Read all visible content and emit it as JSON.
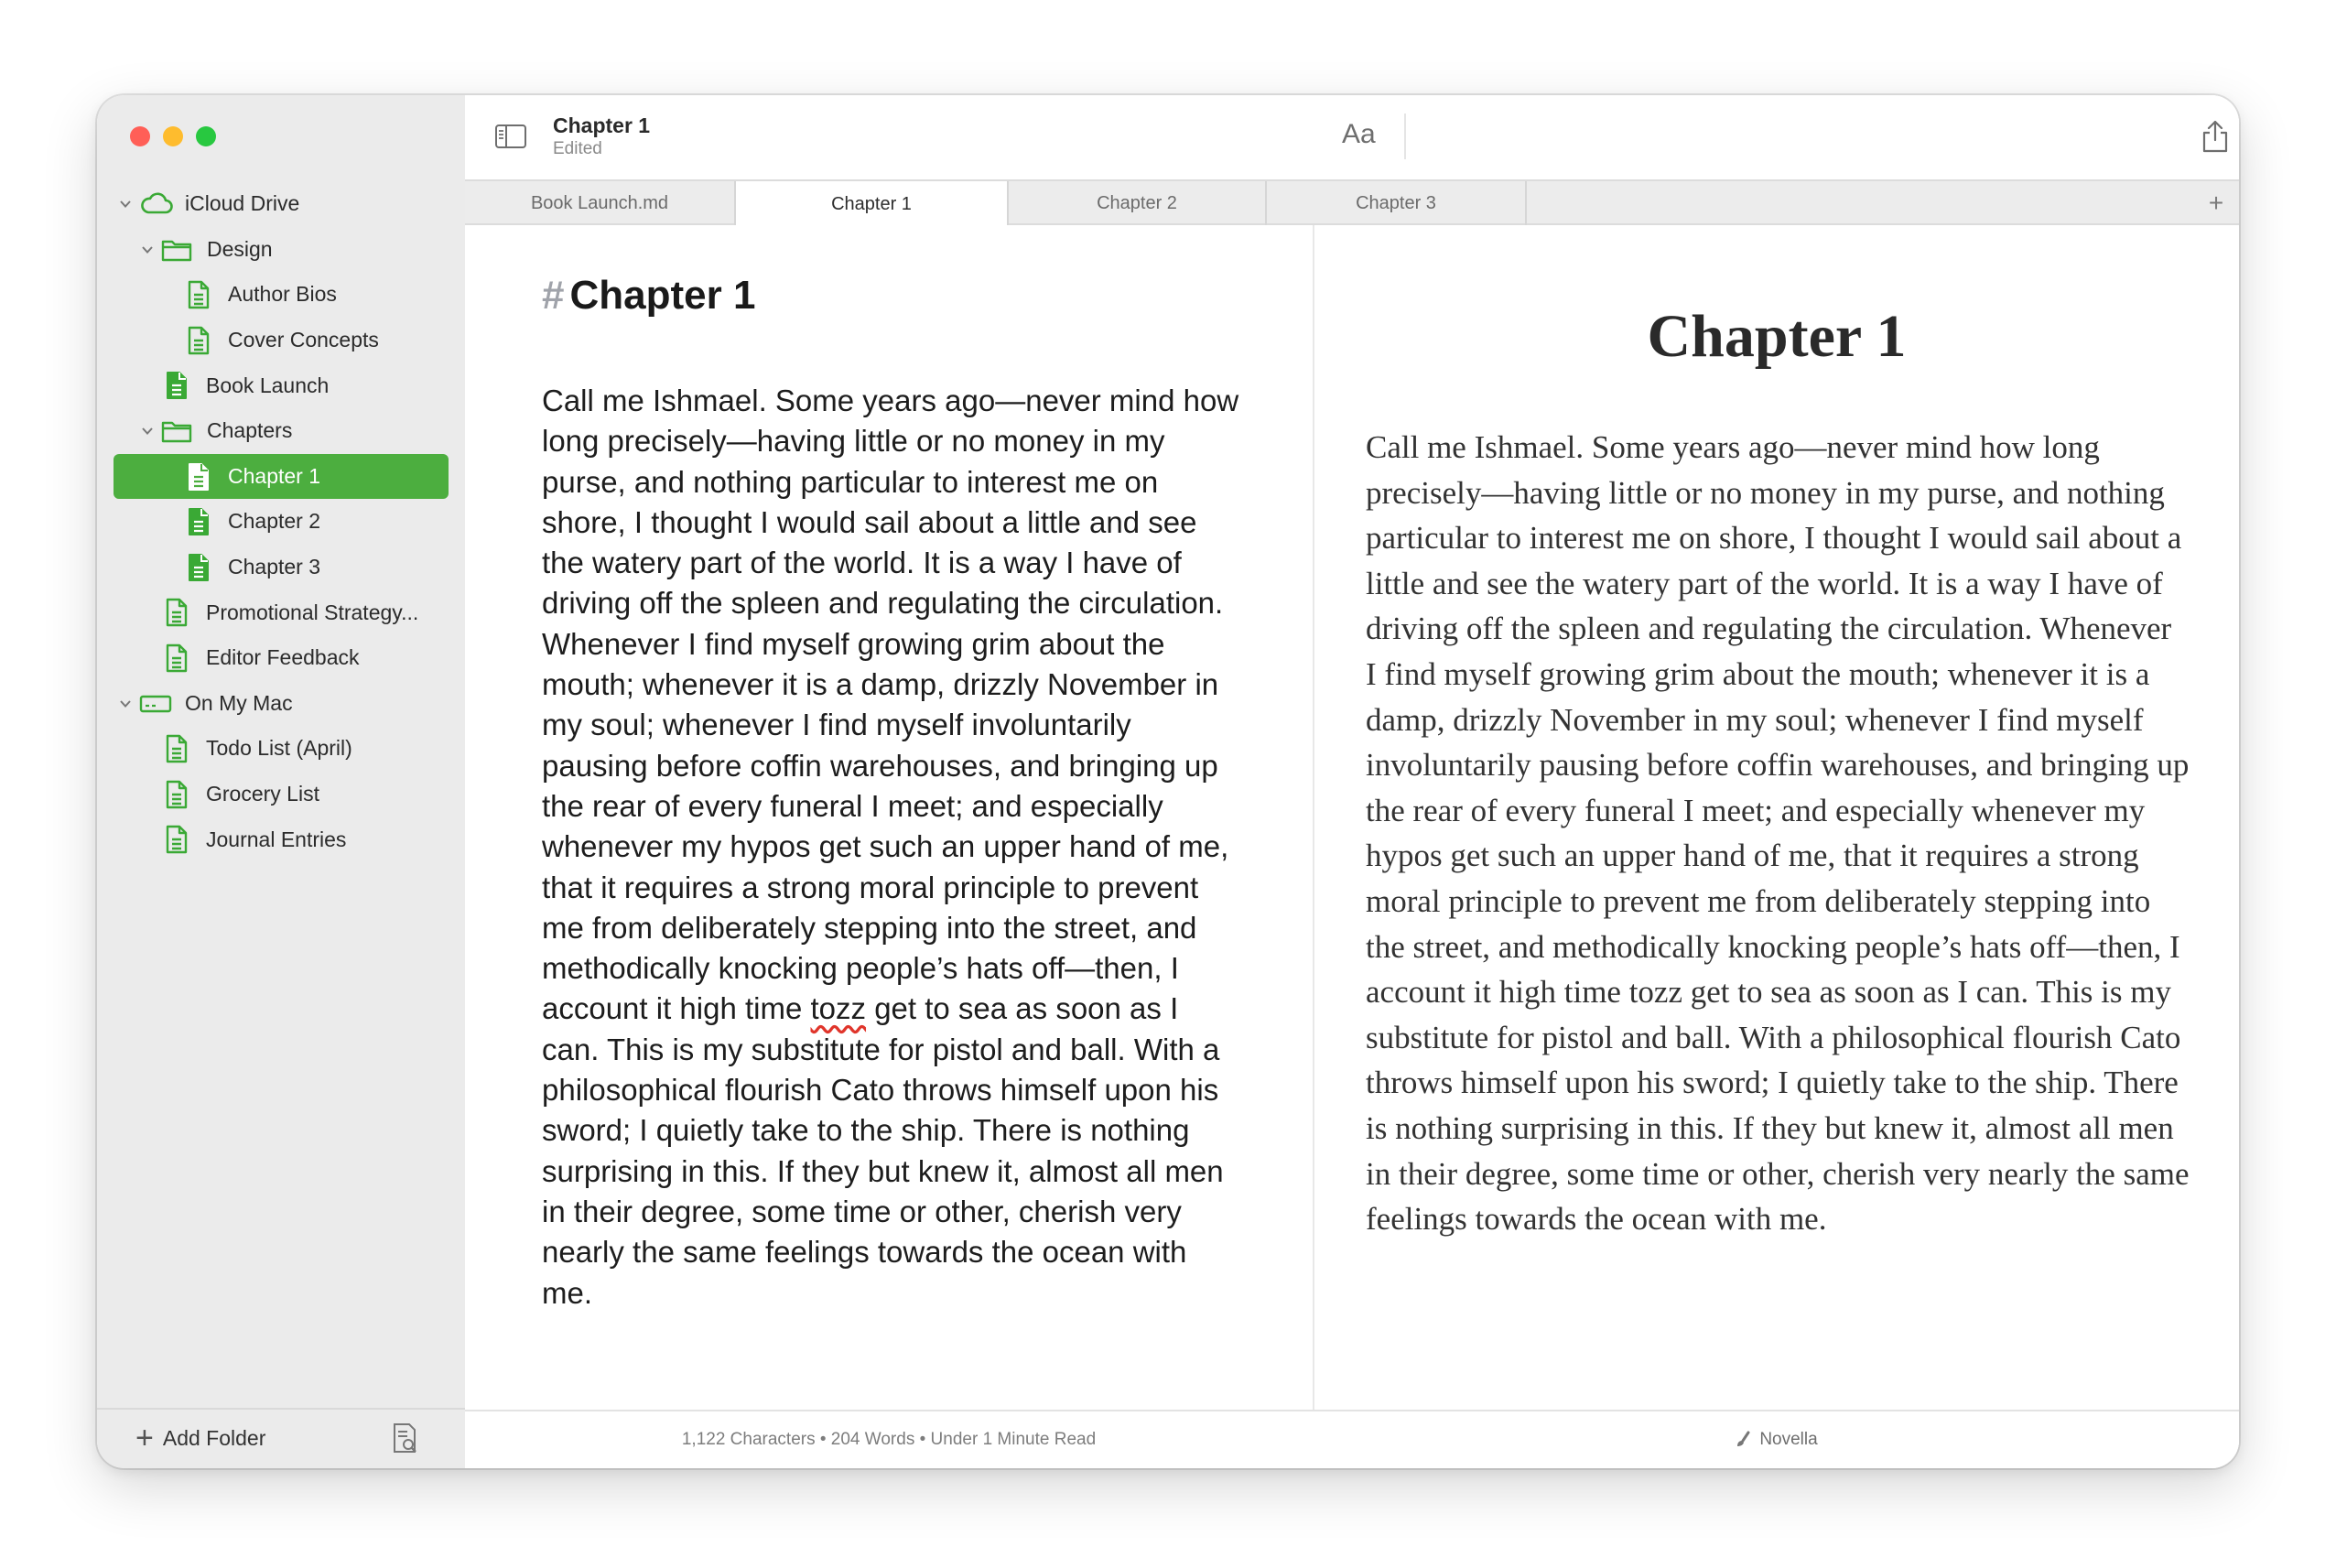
{
  "sidebar": {
    "tree": [
      {
        "key": "icloud",
        "label": "iCloud Drive",
        "icon": "cloud-icon",
        "depth": 0,
        "expanded": true
      },
      {
        "key": "design",
        "label": "Design",
        "icon": "folder-icon",
        "depth": 1,
        "expanded": true
      },
      {
        "key": "author-bios",
        "label": "Author Bios",
        "icon": "document-icon",
        "depth": 2
      },
      {
        "key": "cover-concepts",
        "label": "Cover Concepts",
        "icon": "document-icon",
        "depth": 2
      },
      {
        "key": "book-launch",
        "label": "Book Launch",
        "icon": "document-filled-icon",
        "depth": 1
      },
      {
        "key": "chapters",
        "label": "Chapters",
        "icon": "folder-icon",
        "depth": 1,
        "expanded": true
      },
      {
        "key": "chapter-1",
        "label": "Chapter 1",
        "icon": "document-filled-icon",
        "depth": 2,
        "selected": true
      },
      {
        "key": "chapter-2",
        "label": "Chapter 2",
        "icon": "document-filled-icon",
        "depth": 2
      },
      {
        "key": "chapter-3",
        "label": "Chapter 3",
        "icon": "document-filled-icon",
        "depth": 2
      },
      {
        "key": "promotional",
        "label": "Promotional Strategy...",
        "icon": "document-icon",
        "depth": 1
      },
      {
        "key": "editor-feedback",
        "label": "Editor Feedback",
        "icon": "document-icon",
        "depth": 1
      },
      {
        "key": "on-my-mac",
        "label": "On My Mac",
        "icon": "disk-icon",
        "depth": 0,
        "expanded": true
      },
      {
        "key": "todo",
        "label": "Todo List (April)",
        "icon": "document-icon",
        "depth": 1
      },
      {
        "key": "grocery",
        "label": "Grocery List",
        "icon": "document-icon",
        "depth": 1
      },
      {
        "key": "journal",
        "label": "Journal Entries",
        "icon": "document-icon",
        "depth": 1
      }
    ],
    "add_folder_label": "Add Folder"
  },
  "toolbar": {
    "title": "Chapter 1",
    "subtitle": "Edited",
    "font_button": "Aa"
  },
  "tabs": [
    {
      "label": "Book Launch.md",
      "active": false
    },
    {
      "label": "Chapter 1",
      "active": true
    },
    {
      "label": "Chapter 2",
      "active": false
    },
    {
      "label": "Chapter 3",
      "active": false
    }
  ],
  "tab_add": "+",
  "editor": {
    "heading_marker": "#",
    "heading": "Chapter 1",
    "body_before": "Call me Ishmael. Some years ago—never mind how long precisely—having little or no money in my purse, and nothing particular to interest me on shore, I thought I would sail about a little and see the watery part of the world. It is a way I have of driving off the spleen and regulating the circulation. Whenever I find myself growing grim about the mouth; whenever it is a damp, drizzly November in my soul; whenever I find myself involuntarily pausing before coffin warehouses, and bringing up the rear of every funeral I meet; and especially whenever my hypos get such an upper hand of me, that it requires a strong moral principle to prevent me from deliberately stepping into the street, and methodically knocking people’s hats off—then, I account it high time ",
    "misspelled": "tozz",
    "body_after": " get to sea as soon as I can. This is my substitute for pistol and ball. With a philosophical flourish Cato throws himself upon his sword; I quietly take to the ship. There is nothing surprising in this. If they but knew it, almost all men in their degree, some time or other, cherish very nearly the same feelings towards the ocean with me."
  },
  "preview": {
    "heading": "Chapter 1",
    "body": "Call me Ishmael. Some years ago—never mind how long precisely—having little or no money in my purse, and nothing particular to interest me on shore, I thought I would sail about a little and see the watery part of the world. It is a way I have of driving off the spleen and regulating the circulation. Whenever I find myself growing grim about the mouth; whenever it is a damp, drizzly November in my soul; whenever I find myself involuntarily pausing before coffin warehouses, and bringing up the rear of every funeral I meet; and especially whenever my hypos get such an upper hand of me, that it requires a strong moral principle to prevent me from deliberately stepping into the street, and methodically knocking people’s hats off—then, I account it high time tozz get to sea as soon as I can. This is my substitute for pistol and ball. With a philosophical flourish Cato throws himself upon his sword; I quietly take to the ship. There is nothing surprising in this. If they but knew it, almost all men in their degree, some time or other, cherish very nearly the same feelings towards the ocean with me."
  },
  "status": {
    "stats": "1,122 Characters • 204 Words • Under 1 Minute Read",
    "theme": "Novella"
  },
  "colors": {
    "accent": "#4cae3f",
    "icon_green": "#3aa935"
  }
}
